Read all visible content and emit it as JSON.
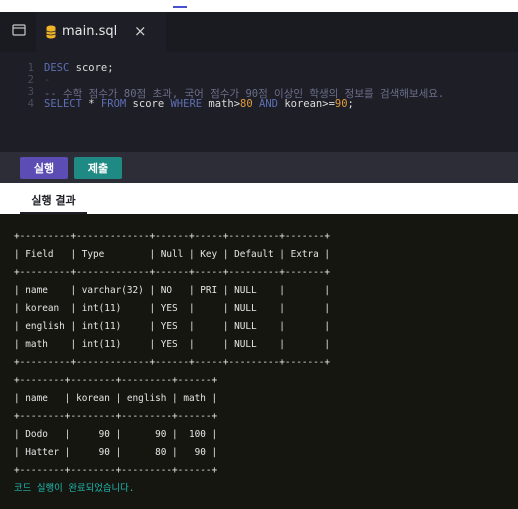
{
  "tab": {
    "title": "main.sql",
    "close": "×"
  },
  "editor": {
    "lines": [
      {
        "num": "1"
      },
      {
        "num": "2"
      },
      {
        "num": "3"
      },
      {
        "num": "4"
      }
    ],
    "code": {
      "l1_kw": "DESC",
      "l1_id": "score;",
      "l2": "-",
      "l3": "-- 수학 점수가 80점 초과, 국어 점수가 90점 이상인 학생의 정보를 검색해보세요.",
      "l4_select": "SELECT",
      "l4_star": "*",
      "l4_from": "FROM",
      "l4_table": "score",
      "l4_where": "WHERE",
      "l4_col1": "math>",
      "l4_v1": "80",
      "l4_and": "AND",
      "l4_col2": "korean>=",
      "l4_v2": "90",
      "l4_end": ";"
    }
  },
  "actions": {
    "run": "실행",
    "submit": "제출"
  },
  "result": {
    "tab_label": "실행 결과",
    "output_text": "+---------+-------------+------+-----+---------+-------+\n| Field   | Type        | Null | Key | Default | Extra |\n+---------+-------------+------+-----+---------+-------+\n| name    | varchar(32) | NO   | PRI | NULL    |       |\n| korean  | int(11)     | YES  |     | NULL    |       |\n| english | int(11)     | YES  |     | NULL    |       |\n| math    | int(11)     | YES  |     | NULL    |       |\n+---------+-------------+------+-----+---------+-------+\n+--------+--------+---------+------+\n| name   | korean | english | math |\n+--------+--------+---------+------+\n| Dodo   |     90 |      90 |  100 |\n| Hatter |     90 |      80 |   90 |\n+--------+--------+---------+------+",
    "status": "코드 실행이 완료되었습니다."
  },
  "colors": {
    "run_button": "#5b4db3",
    "submit_button": "#1f8a83",
    "status_text": "#1fb8b0",
    "number_literal": "#e39a3a",
    "keyword": "#5e6fb3"
  }
}
